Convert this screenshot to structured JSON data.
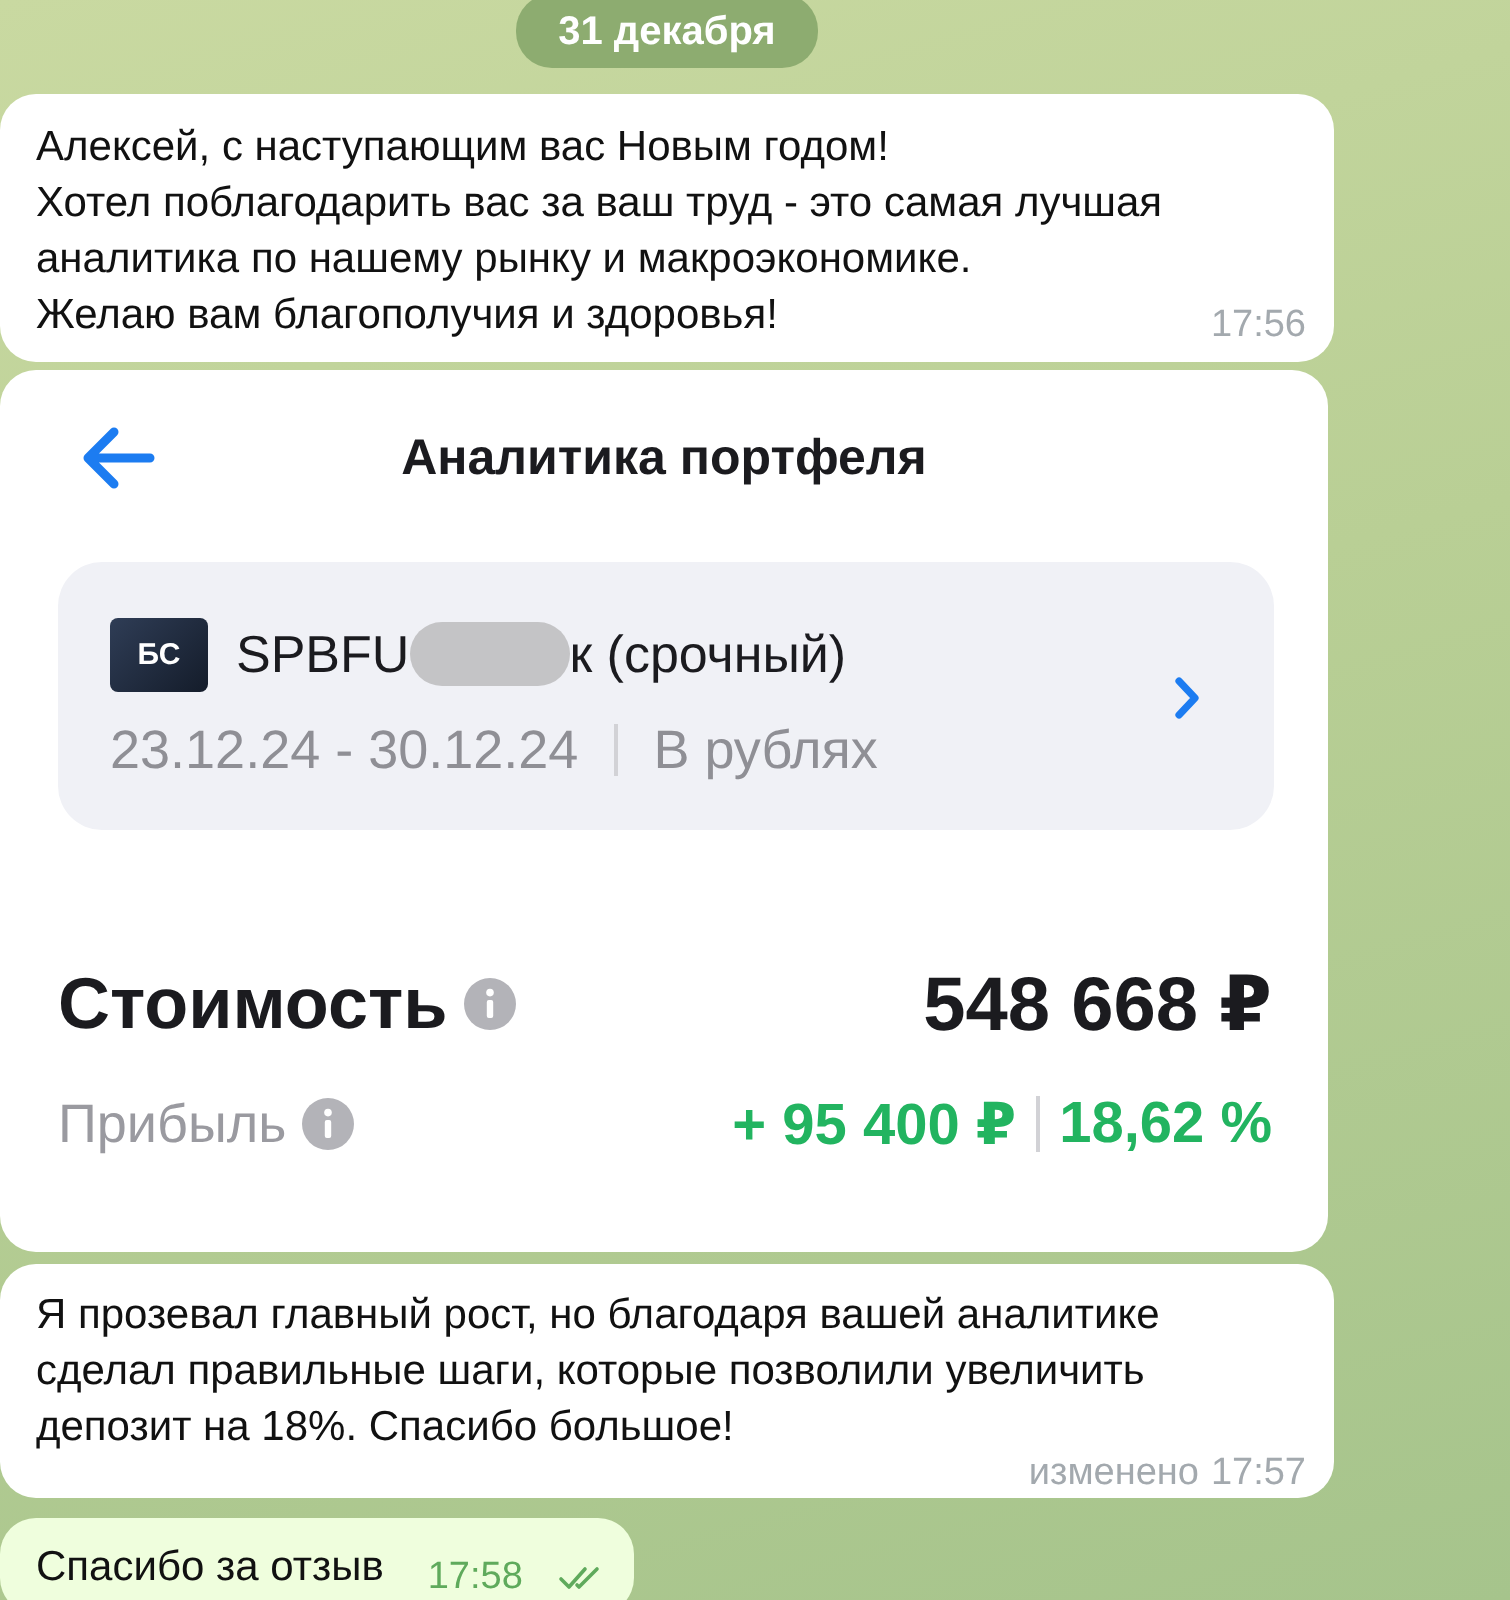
{
  "date_badge": "31 декабря",
  "messages": [
    {
      "kind": "text",
      "outgoing": false,
      "text": "Алексей, с наступающим вас Новым годом!\nХотел поблагодарить вас за ваш труд - это самая лучшая аналитика по нашему рынку и макроэкономике.\nЖелаю вам благополучия и здоровья!",
      "time": "17:56"
    },
    {
      "kind": "screenshot",
      "outgoing": false,
      "screen": {
        "title": "Аналитика портфеля",
        "card": {
          "logo": "БС",
          "name_parts": [
            "SPBFU",
            "к (срочный)"
          ],
          "period": "23.12.24 - 30.12.24",
          "currency": "В рублях"
        },
        "summary": [
          {
            "kind": "total",
            "label": "Стоимость",
            "values": [
              "548 668 ₽"
            ]
          },
          {
            "kind": "profit",
            "label": "Прибыль",
            "values": [
              "+ 95 400 ₽",
              "18,62 %"
            ]
          }
        ]
      }
    },
    {
      "kind": "text",
      "outgoing": false,
      "text": "Я прозевал главный рост, но благодаря вашей аналитике сделал правильные шаги, которые позволили увеличить депозит на 18%. Спасибо большое!",
      "edited_label": "изменено",
      "time": "17:57"
    },
    {
      "kind": "text",
      "outgoing": true,
      "text": "Спасибо за отзыв",
      "time": "17:58",
      "read": true
    }
  ]
}
